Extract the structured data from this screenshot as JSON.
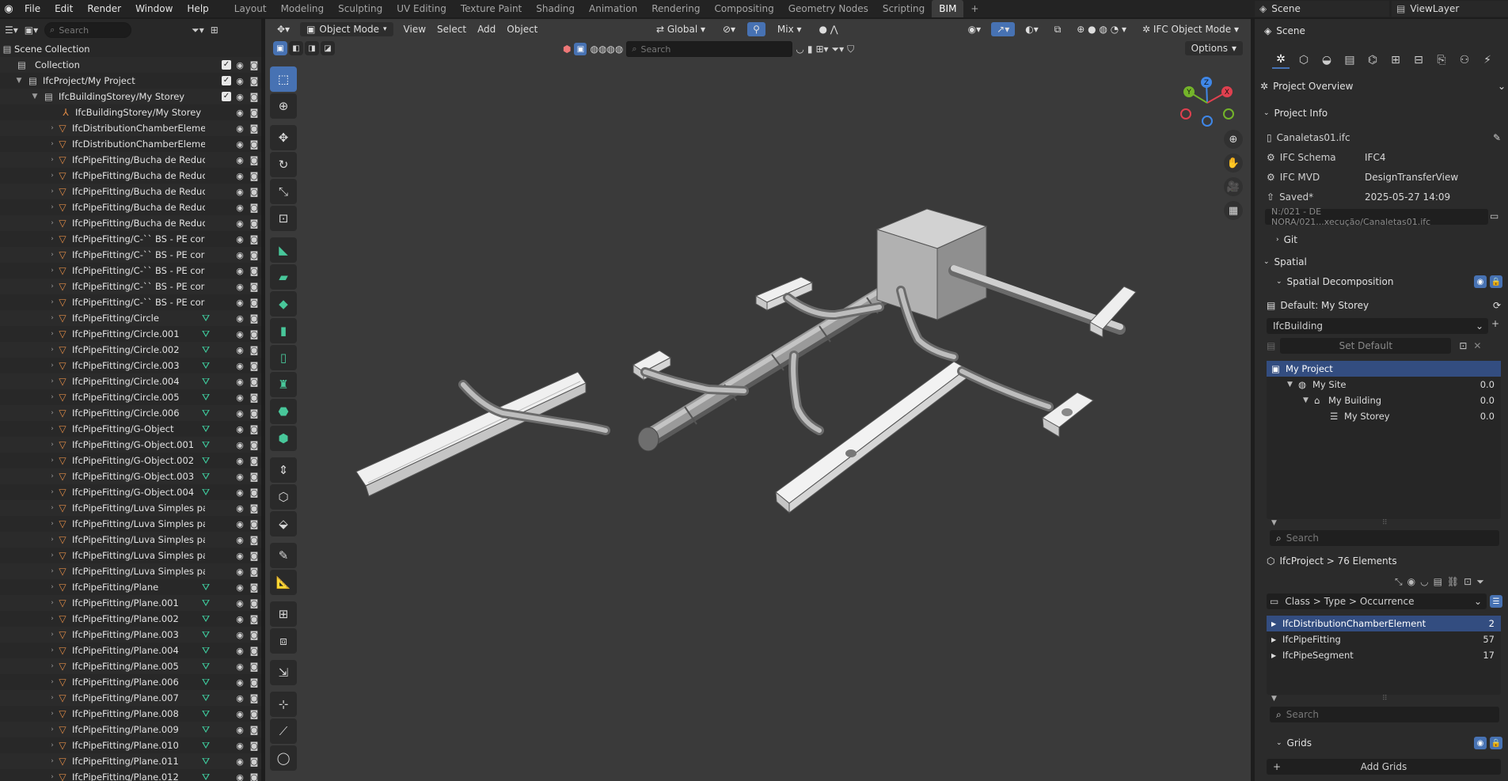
{
  "menus": [
    "File",
    "Edit",
    "Render",
    "Window",
    "Help"
  ],
  "workspaces": [
    "Layout",
    "Modeling",
    "Sculpting",
    "UV Editing",
    "Texture Paint",
    "Shading",
    "Animation",
    "Rendering",
    "Compositing",
    "Geometry Nodes",
    "Scripting",
    "BIM"
  ],
  "active_workspace": "BIM",
  "scene_name": "Scene",
  "view_layer": "ViewLayer",
  "outliner": {
    "search_placeholder": "Search",
    "scene_collection": "Scene Collection",
    "collection": "Collection",
    "project": "IfcProject/My Project",
    "storey_coll": "IfcBuildingStorey/My Storey",
    "storey_obj": "IfcBuildingStorey/My Storey",
    "items": [
      {
        "label": "IfcDistributionChamberElemen",
        "mod": false
      },
      {
        "label": "IfcDistributionChamberElemen",
        "mod": false
      },
      {
        "label": "IfcPipeFitting/Bucha de Reduci",
        "mod": false
      },
      {
        "label": "IfcPipeFitting/Bucha de Reduci",
        "mod": false
      },
      {
        "label": "IfcPipeFitting/Bucha de Reduci",
        "mod": false
      },
      {
        "label": "IfcPipeFitting/Bucha de Reduci",
        "mod": false
      },
      {
        "label": "IfcPipeFitting/Bucha de Reduci",
        "mod": false
      },
      {
        "label": "IfcPipeFitting/C-`` BS - PE cor",
        "mod": false
      },
      {
        "label": "IfcPipeFitting/C-`` BS - PE cor",
        "mod": false
      },
      {
        "label": "IfcPipeFitting/C-`` BS - PE cor",
        "mod": false
      },
      {
        "label": "IfcPipeFitting/C-`` BS - PE cor",
        "mod": false
      },
      {
        "label": "IfcPipeFitting/C-`` BS - PE cor",
        "mod": false
      },
      {
        "label": "IfcPipeFitting/Circle",
        "mod": true
      },
      {
        "label": "IfcPipeFitting/Circle.001",
        "mod": true
      },
      {
        "label": "IfcPipeFitting/Circle.002",
        "mod": true
      },
      {
        "label": "IfcPipeFitting/Circle.003",
        "mod": true
      },
      {
        "label": "IfcPipeFitting/Circle.004",
        "mod": true
      },
      {
        "label": "IfcPipeFitting/Circle.005",
        "mod": true
      },
      {
        "label": "IfcPipeFitting/Circle.006",
        "mod": true
      },
      {
        "label": "IfcPipeFitting/G-Object",
        "mod": true
      },
      {
        "label": "IfcPipeFitting/G-Object.001",
        "mod": true
      },
      {
        "label": "IfcPipeFitting/G-Object.002",
        "mod": true
      },
      {
        "label": "IfcPipeFitting/G-Object.003",
        "mod": true
      },
      {
        "label": "IfcPipeFitting/G-Object.004",
        "mod": true
      },
      {
        "label": "IfcPipeFitting/Luva Simples pa",
        "mod": false
      },
      {
        "label": "IfcPipeFitting/Luva Simples pa",
        "mod": false
      },
      {
        "label": "IfcPipeFitting/Luva Simples pa",
        "mod": false
      },
      {
        "label": "IfcPipeFitting/Luva Simples pa",
        "mod": false
      },
      {
        "label": "IfcPipeFitting/Luva Simples pa",
        "mod": false
      },
      {
        "label": "IfcPipeFitting/Plane",
        "mod": true
      },
      {
        "label": "IfcPipeFitting/Plane.001",
        "mod": true
      },
      {
        "label": "IfcPipeFitting/Plane.002",
        "mod": true
      },
      {
        "label": "IfcPipeFitting/Plane.003",
        "mod": true
      },
      {
        "label": "IfcPipeFitting/Plane.004",
        "mod": true
      },
      {
        "label": "IfcPipeFitting/Plane.005",
        "mod": true
      },
      {
        "label": "IfcPipeFitting/Plane.006",
        "mod": true
      },
      {
        "label": "IfcPipeFitting/Plane.007",
        "mod": true
      },
      {
        "label": "IfcPipeFitting/Plane.008",
        "mod": true
      },
      {
        "label": "IfcPipeFitting/Plane.009",
        "mod": true
      },
      {
        "label": "IfcPipeFitting/Plane.010",
        "mod": true
      },
      {
        "label": "IfcPipeFitting/Plane.011",
        "mod": true
      },
      {
        "label": "IfcPipeFitting/Plane.012",
        "mod": true
      }
    ]
  },
  "viewport": {
    "mode": "Object Mode",
    "menus": [
      "View",
      "Select",
      "Add",
      "Object"
    ],
    "transform": "Global",
    "snap": "Mix",
    "ifc_mode": "IFC Object Mode",
    "search_placeholder": "Search",
    "options": "Options"
  },
  "props": {
    "header": "Scene",
    "panel": "Project Overview",
    "project_info": "Project Info",
    "file": "Canaletas01.ifc",
    "schema_k": "IFC Schema",
    "schema_v": "IFC4",
    "mvd_k": "IFC MVD",
    "mvd_v": "DesignTransferView",
    "saved_k": "Saved*",
    "saved_v": "2025-05-27 14:09",
    "path": "N:/021 - DE  NORA/021...xecução/Canaletas01.ifc",
    "git": "Git",
    "spatial": "Spatial",
    "spatial_decomp": "Spatial Decomposition",
    "default": "Default: My Storey",
    "building_type": "IfcBuilding",
    "set_default": "Set Default",
    "tree": [
      {
        "label": "My Project",
        "val": "",
        "depth": 0,
        "sel": true,
        "icon": "▣"
      },
      {
        "label": "My Site",
        "val": "0.0",
        "depth": 1,
        "sel": false,
        "icon": "◍"
      },
      {
        "label": "My Building",
        "val": "0.0",
        "depth": 2,
        "sel": false,
        "icon": "⌂"
      },
      {
        "label": "My Storey",
        "val": "0.0",
        "depth": 3,
        "sel": false,
        "icon": "☰"
      }
    ],
    "search": "Search",
    "elements": "IfcProject > 76 Elements",
    "grouping": "Class > Type > Occurrence",
    "classes": [
      {
        "label": "IfcDistributionChamberElement",
        "val": "2",
        "sel": true
      },
      {
        "label": "IfcPipeFitting",
        "val": "57",
        "sel": false
      },
      {
        "label": "IfcPipeSegment",
        "val": "17",
        "sel": false
      }
    ],
    "search2": "Search",
    "grids": "Grids",
    "add_grids": "Add Grids"
  },
  "gizmo_axes": [
    "X",
    "Y",
    "Z"
  ],
  "colors": {
    "accent": "#4772b3",
    "x": "#e0404f",
    "y": "#74b42a",
    "z": "#3f87e8",
    "mesh": "#e28c46",
    "modifier": "#3fcfa0"
  }
}
